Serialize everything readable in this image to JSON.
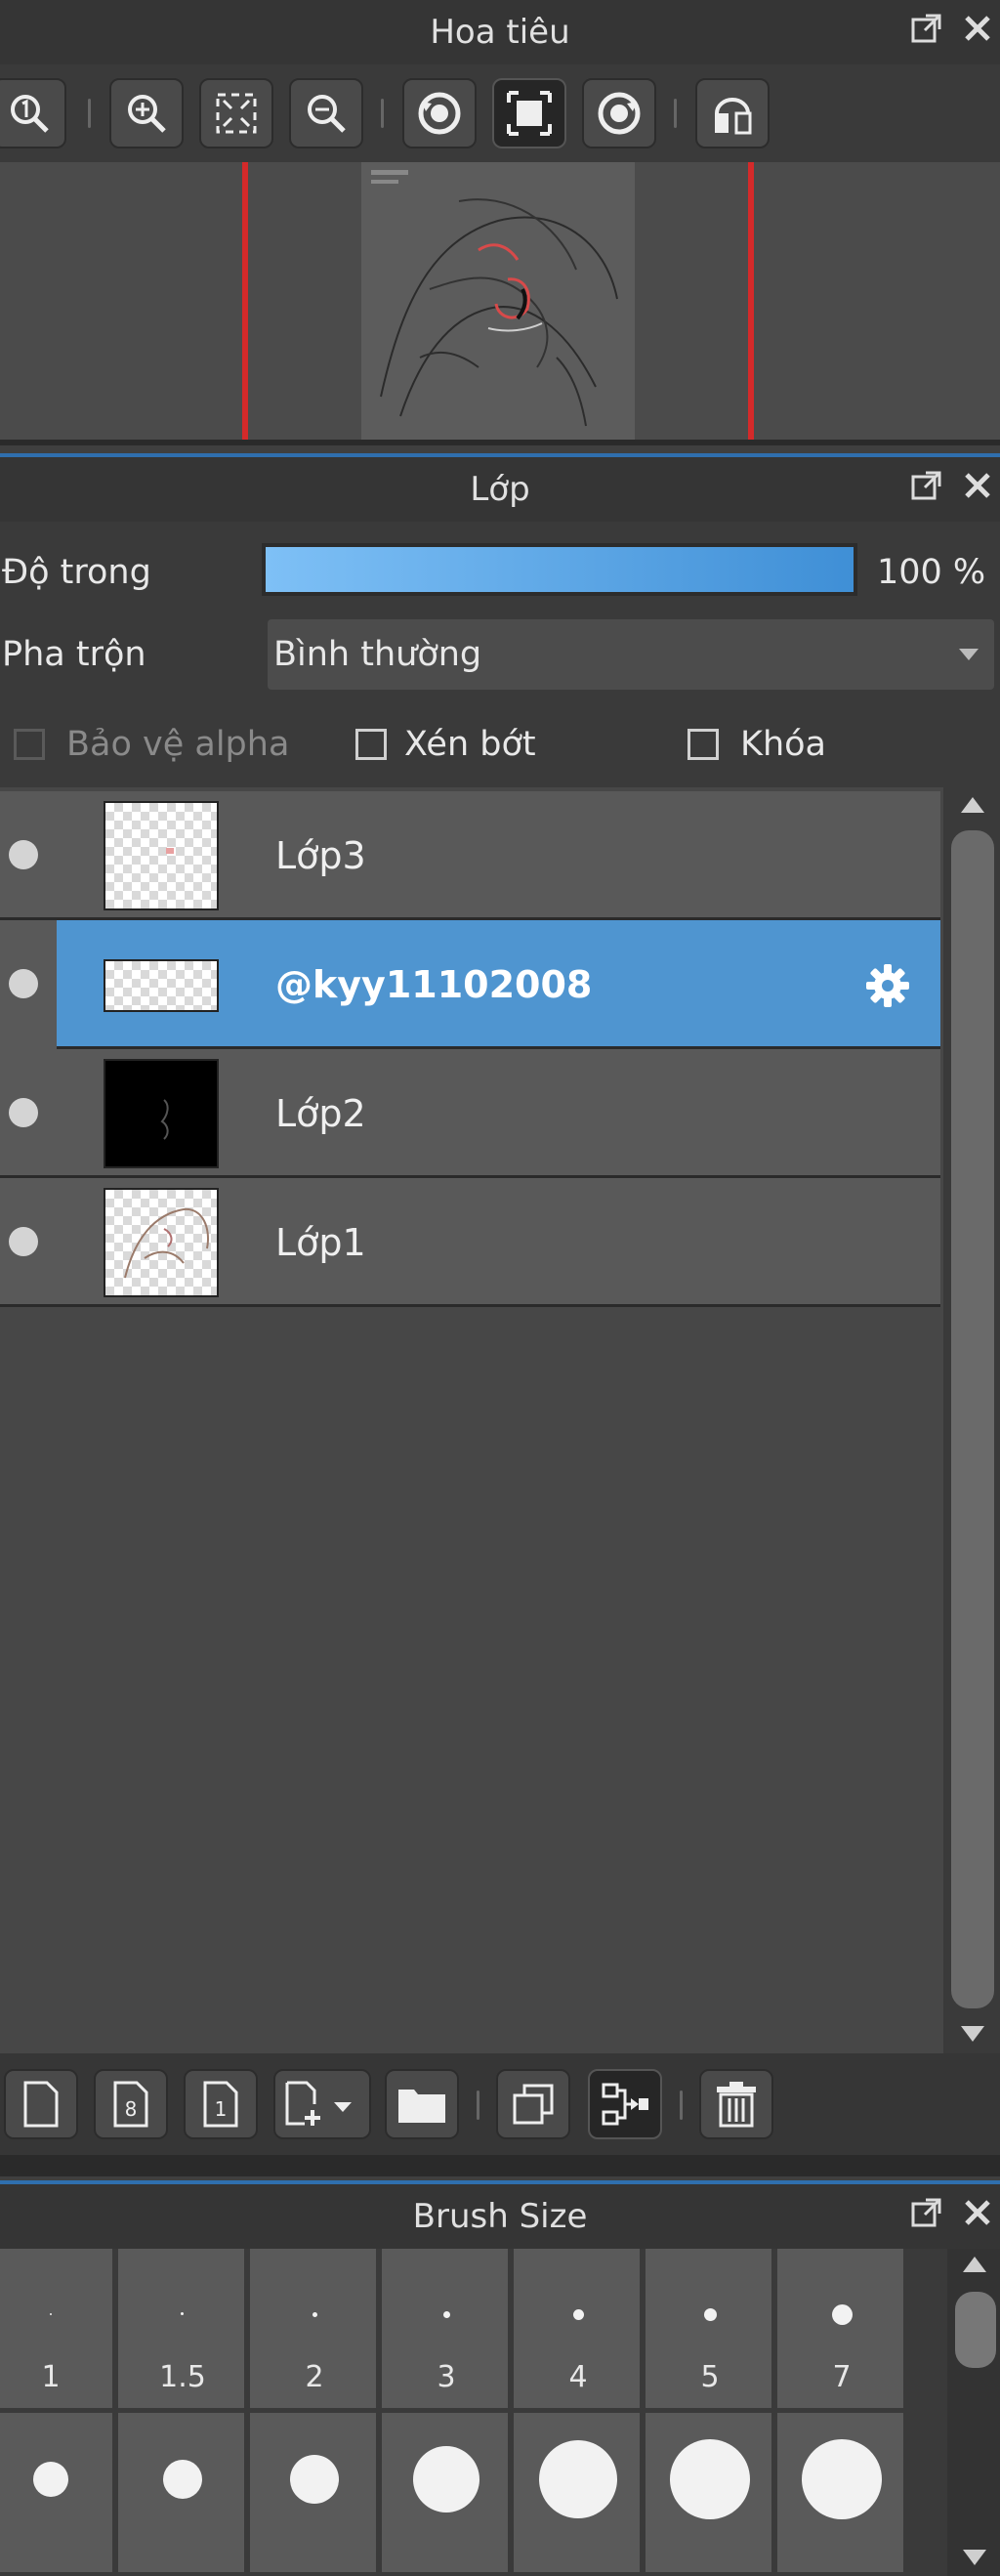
{
  "navigator": {
    "title": "Hoa tiêu",
    "tools": [
      "zoom-actual-icon",
      "zoom-in-icon",
      "fit-screen-icon",
      "zoom-out-icon",
      "rotate-left-icon",
      "reset-view-icon",
      "rotate-right-icon",
      "flip-horizontal-icon"
    ]
  },
  "layers": {
    "title": "Lớp",
    "opacity_label": "Độ trong",
    "opacity_value": "100 %",
    "opacity_fraction": 1.0,
    "blend_label": "Pha trộn",
    "blend_value": "Bình thường",
    "protect_alpha": "Bảo vệ alpha",
    "clipping": "Xén bớt",
    "lock": "Khóa",
    "items": [
      {
        "name": "Lớp3",
        "selected": false
      },
      {
        "name": "@kyy11102008",
        "selected": true
      },
      {
        "name": "Lớp2",
        "selected": false
      },
      {
        "name": "Lớp1",
        "selected": false
      }
    ],
    "bottom_tools": [
      "new-layer-icon",
      "new-8bit-layer-icon",
      "new-1bit-layer-icon",
      "add-layer-menu-icon",
      "new-folder-icon",
      "duplicate-layer-icon",
      "merge-layer-icon",
      "delete-layer-icon"
    ]
  },
  "brush_size": {
    "title": "Brush Size",
    "row1": [
      "1",
      "1.5",
      "2",
      "3",
      "4",
      "5",
      "7"
    ]
  },
  "colors": {
    "accent": "#4f95d0",
    "panel_bg": "#3f3f3f",
    "red_frame": "#d42a2a"
  }
}
